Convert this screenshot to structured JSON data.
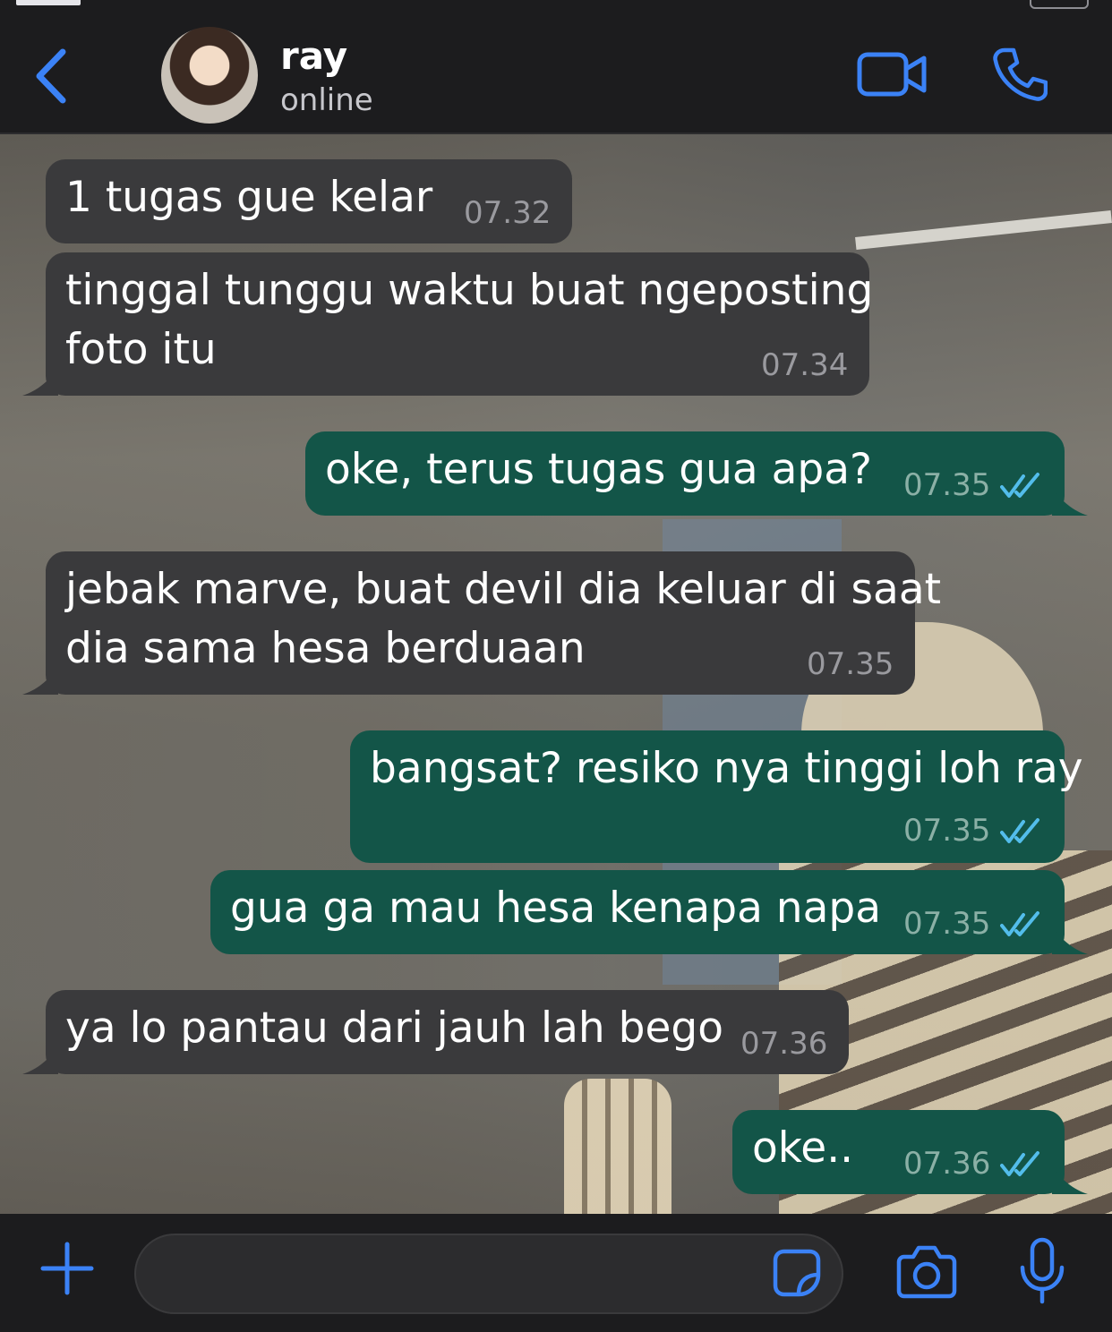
{
  "header": {
    "contact_name": "ray",
    "contact_status": "online"
  },
  "icons": {
    "back": "chevron-left-icon",
    "video_call": "video-camera-icon",
    "voice_call": "phone-icon",
    "attach": "plus-icon",
    "sticker": "sticker-icon",
    "camera": "camera-icon",
    "mic": "microphone-icon",
    "read_receipt": "double-check-icon"
  },
  "colors": {
    "accent": "#3b82f6",
    "incoming_bubble": "#3a3a3c",
    "outgoing_bubble": "#135548",
    "read_tick": "#53bdeb"
  },
  "messages": [
    {
      "direction": "in",
      "text": "1 tugas gue kelar",
      "time": "07.32"
    },
    {
      "direction": "in",
      "text": "tinggal tunggu waktu buat ngeposting\nfoto itu",
      "time": "07.34"
    },
    {
      "direction": "out",
      "text": "oke, terus tugas gua apa?",
      "time": "07.35",
      "status": "read"
    },
    {
      "direction": "in",
      "text": "jebak marve, buat devil dia keluar di saat\ndia sama hesa berduaan",
      "time": "07.35"
    },
    {
      "direction": "out",
      "text": "bangsat? resiko nya tinggi loh ray",
      "time": "07.35",
      "status": "read"
    },
    {
      "direction": "out",
      "text": "gua ga mau hesa kenapa napa",
      "time": "07.35",
      "status": "read"
    },
    {
      "direction": "in",
      "text": "ya lo pantau dari jauh lah bego",
      "time": "07.36"
    },
    {
      "direction": "out",
      "text": "oke..",
      "time": "07.36",
      "status": "read"
    }
  ],
  "composer": {
    "value": ""
  }
}
